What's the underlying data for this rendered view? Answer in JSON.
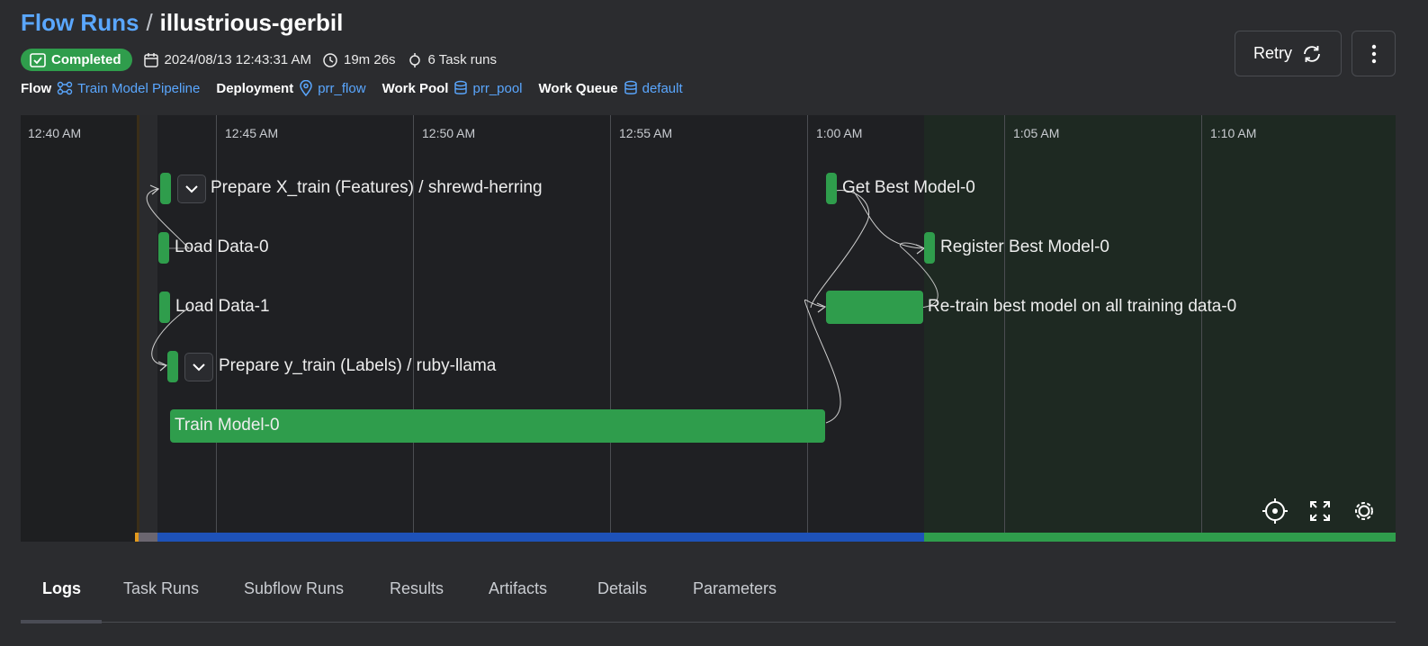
{
  "breadcrumb": {
    "root": "Flow Runs",
    "separator": "/",
    "run_name": "illustrious-gerbil"
  },
  "status": {
    "label": "Completed",
    "color": "#2f9d4c"
  },
  "meta": {
    "start_time": "2024/08/13 12:43:31 AM",
    "duration": "19m 26s",
    "task_runs": "6 Task runs"
  },
  "properties": {
    "flow_label": "Flow",
    "flow_value": "Train Model Pipeline",
    "deployment_label": "Deployment",
    "deployment_value": "prr_flow",
    "work_pool_label": "Work Pool",
    "work_pool_value": "prr_pool",
    "work_queue_label": "Work Queue",
    "work_queue_value": "default"
  },
  "actions": {
    "retry_label": "Retry",
    "more_icon": "kebab-icon"
  },
  "timeline": {
    "ticks": [
      "12:40 AM",
      "12:45 AM",
      "12:50 AM",
      "12:55 AM",
      "1:00 AM",
      "1:05 AM",
      "1:10 AM"
    ],
    "nodes": [
      {
        "label": "Prepare X_train (Features) / shrewd-herring"
      },
      {
        "label": "Load Data-0"
      },
      {
        "label": "Load Data-1"
      },
      {
        "label": "Prepare y_train (Labels) / ruby-llama"
      },
      {
        "label": "Train Model-0"
      },
      {
        "label": "Get Best Model-0"
      },
      {
        "label": "Register Best Model-0"
      },
      {
        "label": "Re-train best model on all training data-0"
      }
    ],
    "tools": [
      "recenter-icon",
      "fullscreen-icon",
      "settings-icon"
    ],
    "colors": {
      "bar": "#2f9d4c",
      "pending": "#e39a1d",
      "running": "#1e52b8",
      "completed": "#2f9d4c"
    }
  },
  "tabs": [
    "Logs",
    "Task Runs",
    "Subflow Runs",
    "Results",
    "Artifacts",
    "Details",
    "Parameters"
  ],
  "active_tab": "Logs"
}
